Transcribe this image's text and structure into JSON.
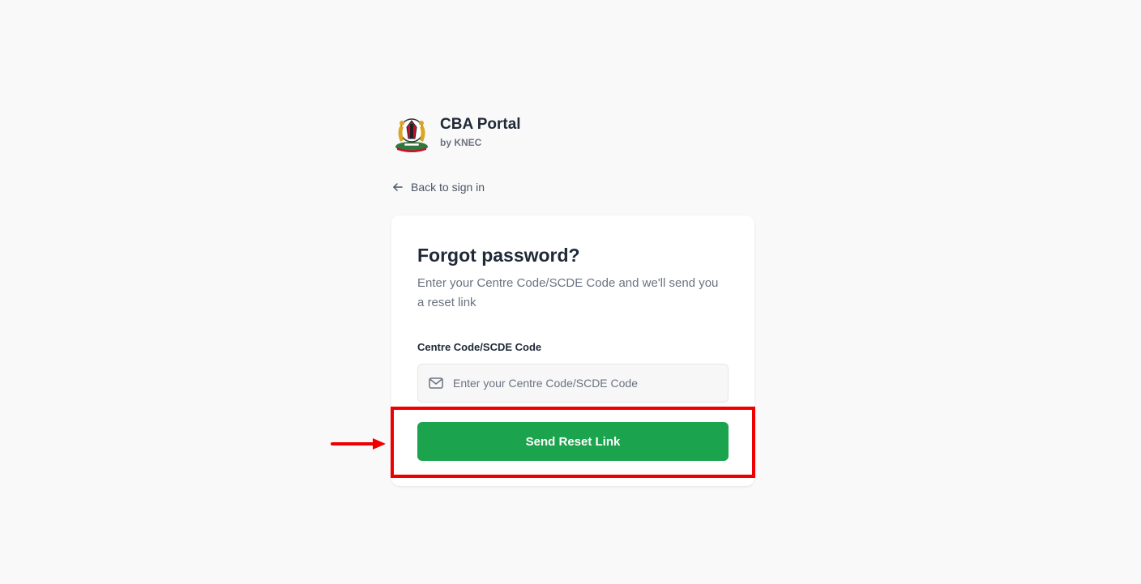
{
  "brand": {
    "title": "CBA Portal",
    "subtitle": "by KNEC",
    "logo_icon": "kenya-coat-of-arms-icon"
  },
  "back_link": {
    "label": "Back to sign in",
    "icon": "arrow-left-icon"
  },
  "card": {
    "title": "Forgot password?",
    "description": "Enter your Centre Code/SCDE Code and we'll send you a reset link",
    "field": {
      "label": "Centre Code/SCDE Code",
      "placeholder": "Enter your Centre Code/SCDE Code",
      "value": "",
      "icon": "mail-icon"
    },
    "submit_label": "Send Reset Link"
  },
  "annotation": {
    "highlight_color": "#ef0000",
    "arrow_icon": "arrow-right-icon"
  },
  "colors": {
    "primary": "#1ca34d",
    "background": "#f9f9f9"
  }
}
